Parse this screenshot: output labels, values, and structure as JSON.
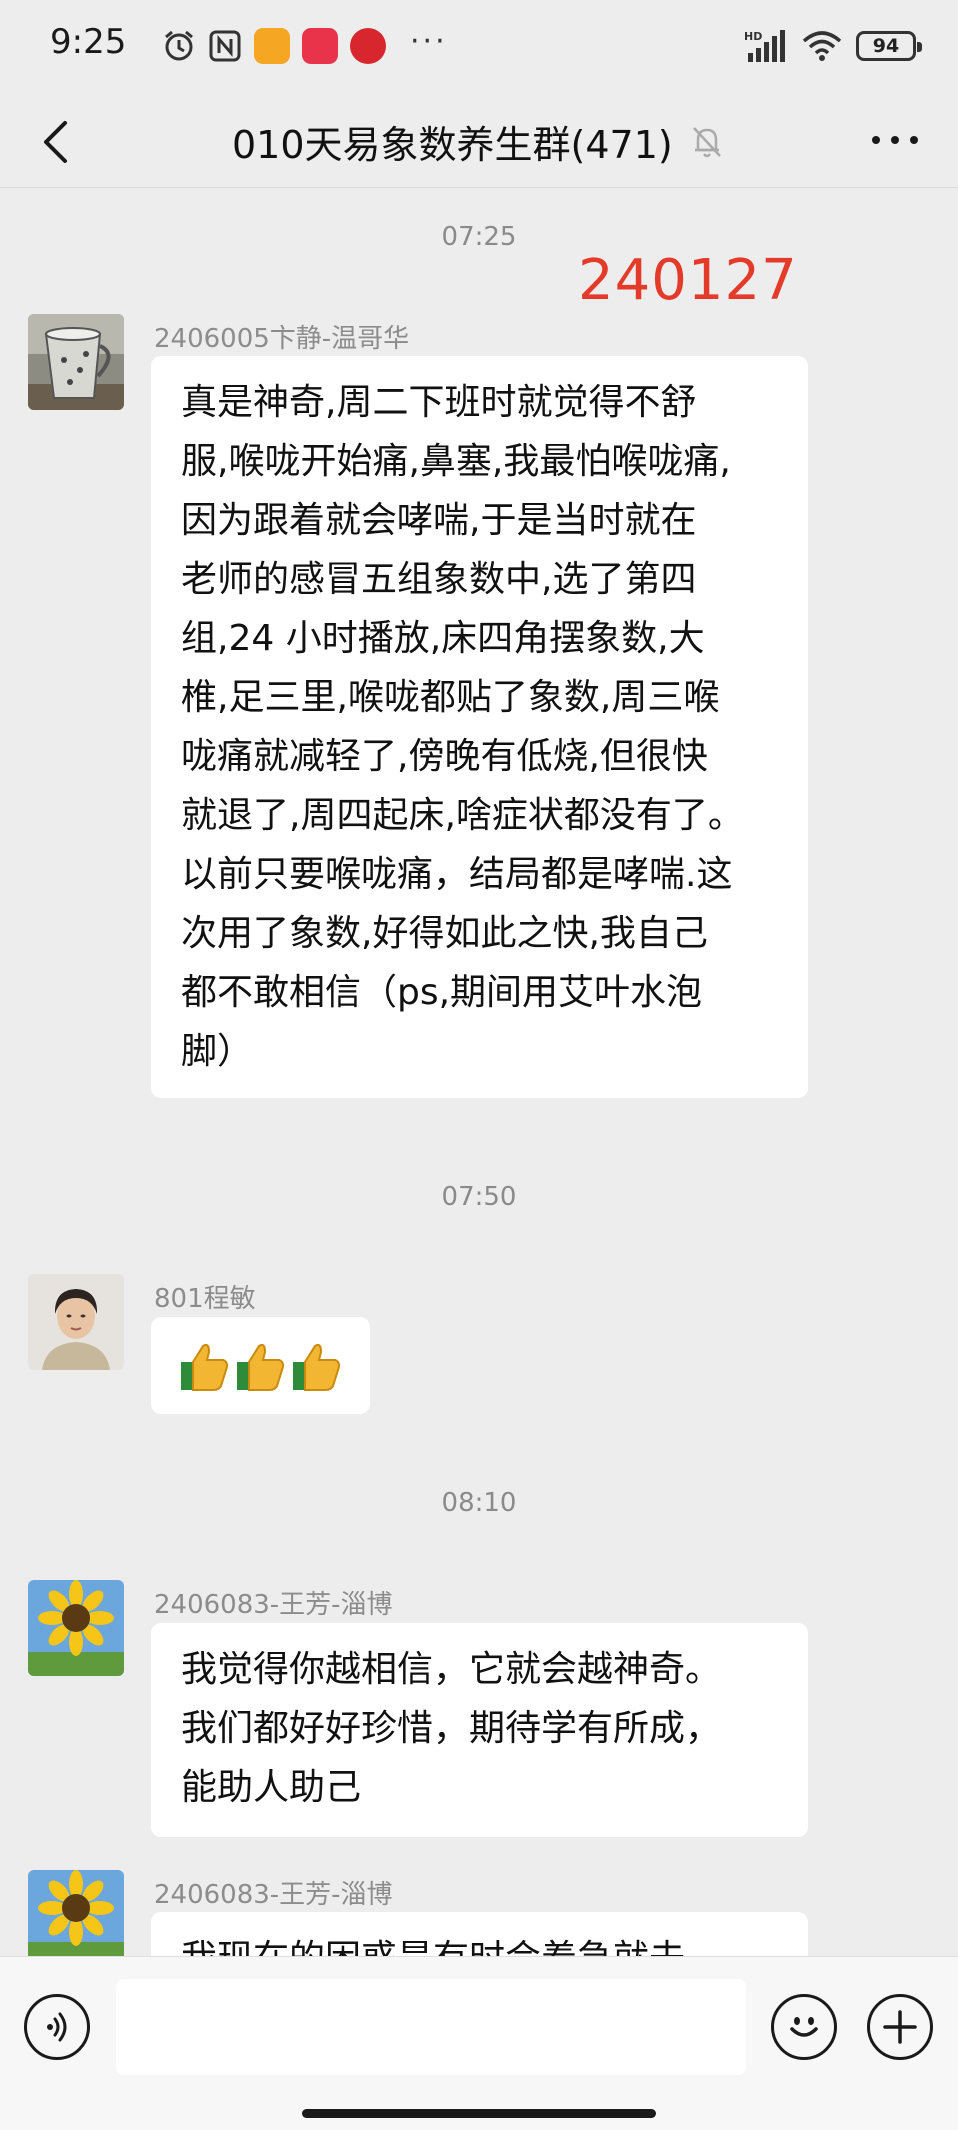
{
  "status_bar": {
    "time": "9:25",
    "battery": "94",
    "network": "HD"
  },
  "header": {
    "title": "010天易象数养生群(471)"
  },
  "stamp": "240127",
  "messages": [
    {
      "time": "07:25",
      "sender": "2406005卞静-温哥华",
      "lines": [
        "真是神奇,周二下班时就觉得不舒",
        "服,喉咙开始痛,鼻塞,我最怕喉咙痛,",
        "因为跟着就会哮喘,于是当时就在",
        "老师的感冒五组象数中,选了第四",
        "组,24 小时播放,床四角摆象数,大",
        "椎,足三里,喉咙都贴了象数,周三喉",
        "咙痛就减轻了,傍晚有低烧,但很快",
        "就退了,周四起床,啥症状都没有了。",
        "以前只要喉咙痛，结局都是哮喘.这",
        "次用了象数,好得如此之快,我自己",
        "都不敢相信（ps,期间用艾叶水泡",
        "脚）"
      ]
    },
    {
      "time": "07:50",
      "sender": "801程敏",
      "emoji": "👍👍👍"
    },
    {
      "time": "08:10",
      "sender": "2406083-王芳-淄博",
      "lines": [
        "我觉得你越相信，它就会越神奇。",
        "我们都好好珍惜，期待学有所成，",
        "能助人助己"
      ]
    },
    {
      "sender": "2406083-王芳-淄博",
      "lines": [
        "我现在的困惑是有时会着急就去"
      ]
    }
  ],
  "colors": {
    "background": "#ededed",
    "bubble": "#ffffff",
    "stamp": "#e43a2a",
    "meta_text": "#8c8c8c"
  },
  "icons": [
    "back-arrow-icon",
    "mute-bell-icon",
    "more-dots-icon",
    "voice-icon",
    "emoji-icon",
    "plus-icon"
  ]
}
